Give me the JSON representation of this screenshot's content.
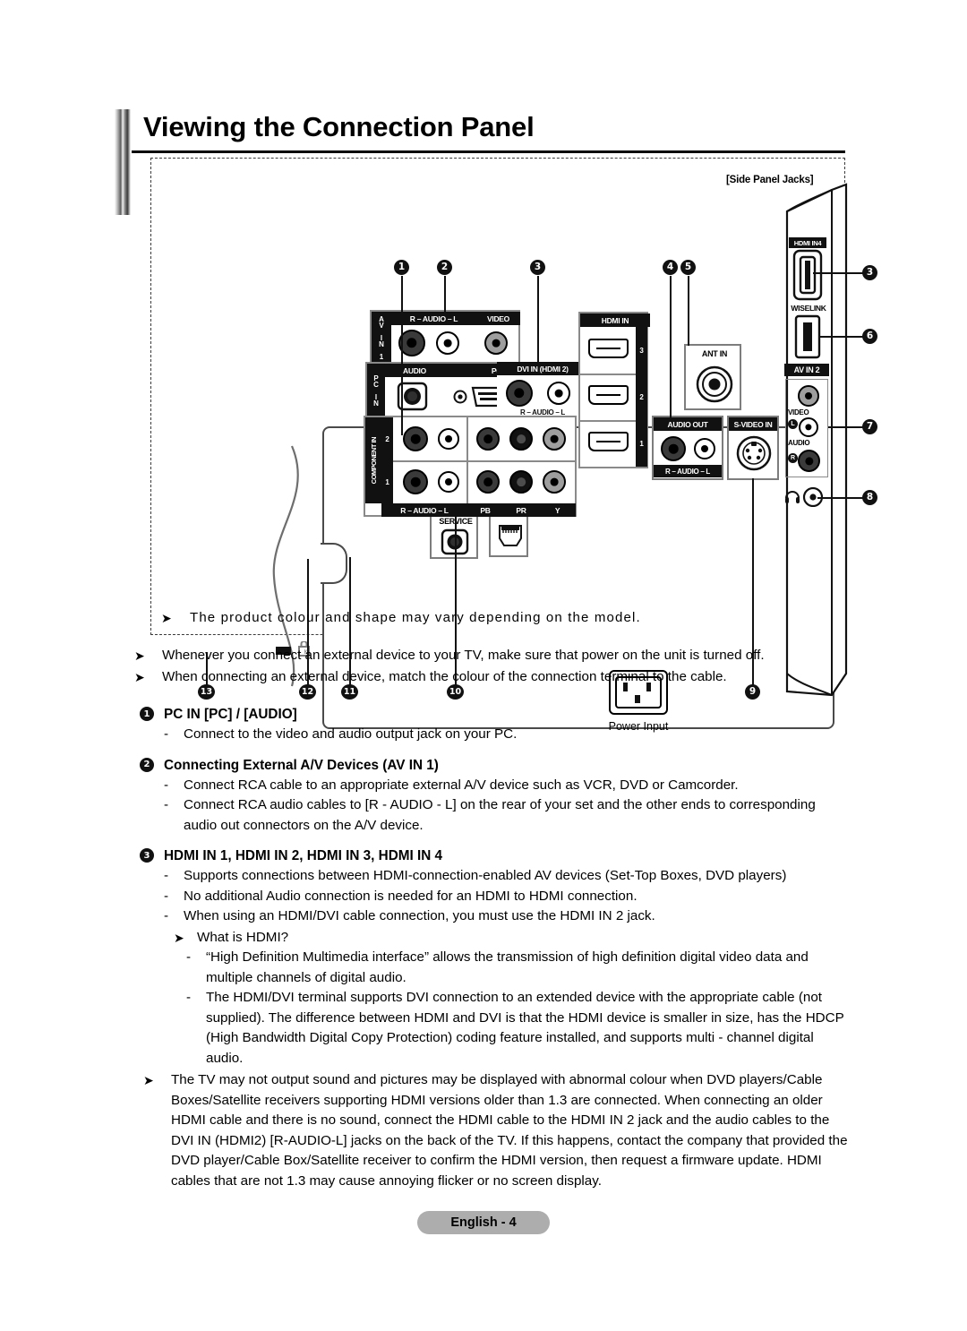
{
  "page": {
    "title": "Viewing the Connection Panel",
    "footer_label": "English - 4"
  },
  "diagram": {
    "side_panel_tag": "[Side Panel Jacks]",
    "power_input_label": "Power Input",
    "rear_labels": {
      "service": "SERVICE",
      "lan": "LAN",
      "av_in_1": "AV IN 1",
      "av_in_1_audio": "R – AUDIO – L",
      "av_in_1_video": "VIDEO",
      "pc_in": "PC IN",
      "pc_audio": "AUDIO",
      "pc": "PC",
      "dvi_in": "DVI IN (HDMI 2)",
      "dvi_audio": "R – AUDIO – L",
      "component_in": "COMPONENT IN",
      "component_row_2": "2",
      "component_row_1": "1",
      "component_audio": "R – AUDIO – L",
      "component_pb": "PB",
      "component_pr": "PR",
      "component_y": "Y",
      "hdmi_in": "HDMI IN",
      "hdmi_3": "3",
      "hdmi_2": "2",
      "hdmi_1": "1",
      "audio_out": "AUDIO OUT",
      "audio_out_rl": "R – AUDIO – L",
      "s_video_in": "S-VIDEO IN",
      "ant_in": "ANT IN"
    },
    "side_labels": {
      "hdmi_in_4": "HDMI IN4",
      "wiselink": "WISELINK",
      "av_in_2": "AV IN 2",
      "video": "VIDEO",
      "audio": "AUDIO",
      "left_ch": "L",
      "right_ch": "R"
    },
    "callouts": [
      {
        "id": "c1",
        "label": "1"
      },
      {
        "id": "c2",
        "label": "2"
      },
      {
        "id": "c3",
        "label": "3"
      },
      {
        "id": "c4",
        "label": "4"
      },
      {
        "id": "c5",
        "label": "5"
      },
      {
        "id": "c3b",
        "label": "3"
      },
      {
        "id": "c6",
        "label": "6"
      },
      {
        "id": "c7",
        "label": "7"
      },
      {
        "id": "c8",
        "label": "8"
      },
      {
        "id": "c9",
        "label": "9"
      },
      {
        "id": "c10",
        "label": "10"
      },
      {
        "id": "c11",
        "label": "11"
      },
      {
        "id": "c12",
        "label": "12"
      },
      {
        "id": "c13",
        "label": "13"
      }
    ]
  },
  "notes": {
    "boxed": "The  product  colour  and  shape  may  vary  depending  on  the  model.",
    "bullet_1": "Whenever you connect an external device to your TV, make sure that power on the unit is turned off.",
    "bullet_2": "When connecting an external device, match the colour of the connection terminal to the cable."
  },
  "sections": [
    {
      "num": "1",
      "heading": "PC IN [PC] / [AUDIO]",
      "items": [
        "Connect to the video and audio output jack on your PC."
      ]
    },
    {
      "num": "2",
      "heading": "Connecting External A/V Devices (AV IN 1)",
      "items": [
        "Connect RCA cable to an appropriate external A/V device such as VCR, DVD or Camcorder.",
        "Connect RCA audio cables to [R - AUDIO - L] on the rear of your set and the other ends to corresponding audio out connectors on the A/V device."
      ]
    },
    {
      "num": "3",
      "heading": "HDMI IN 1, HDMI IN 2, HDMI IN 3, HDMI IN 4",
      "items": [
        "Supports connections between HDMI-connection-enabled AV devices (Set-Top Boxes, DVD players)",
        "No additional Audio connection is needed for an HDMI to HDMI connection.",
        "When using an HDMI/DVI cable connection, you must use the HDMI IN 2 jack."
      ],
      "sub_arrow": "What is HDMI?",
      "sub_items": [
        "“High Definition Multimedia interface” allows the transmission of high definition digital video data and multiple channels of digital audio.",
        "The HDMI/DVI terminal supports DVI connection to an extended device with the appropriate cable (not supplied). The difference between HDMI and DVI is that the HDMI device is smaller in size, has the HDCP (High Bandwidth Digital Copy Protection) coding feature installed, and supports multi - channel digital audio."
      ],
      "closing_note": "The TV may not output sound and pictures may be displayed with abnormal colour when DVD players/Cable Boxes/Satellite receivers supporting HDMI versions older than 1.3 are connected. When connecting an older HDMI cable and there is no sound, connect the HDMI cable to the HDMI IN 2 jack and the audio cables to the DVI IN (HDMI2) [R-AUDIO-L] jacks on the back of the TV. If this happens, contact the company that provided the DVD player/Cable Box/Satellite receiver to confirm the HDMI version, then request a firmware update. HDMI cables that are not 1.3 may cause annoying flicker or no screen display."
    }
  ]
}
